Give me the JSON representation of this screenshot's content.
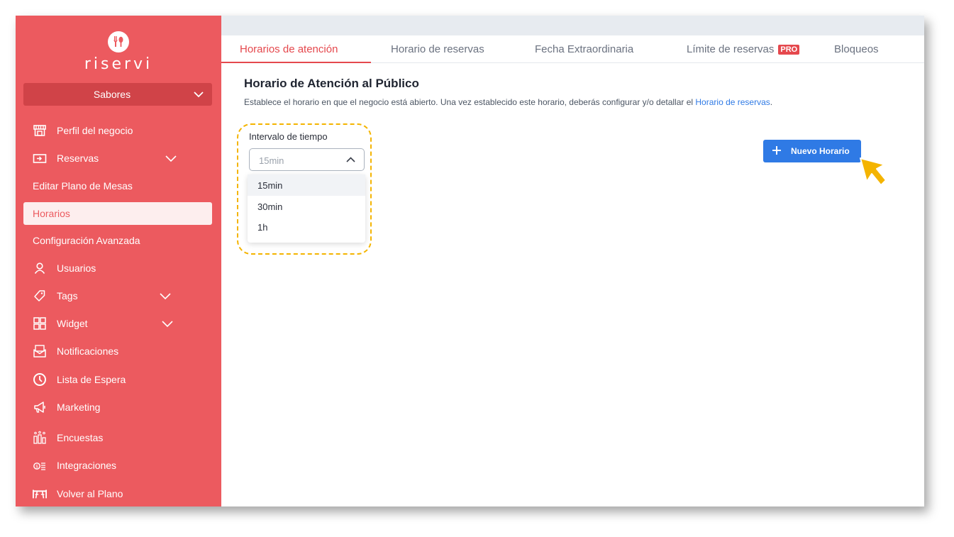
{
  "brand": {
    "name": "riservi"
  },
  "sidebar": {
    "restaurant_selector": "Sabores",
    "items": [
      {
        "label": "Perfil del negocio"
      },
      {
        "label": "Reservas"
      },
      {
        "label": "Editar Plano de Mesas"
      },
      {
        "label": "Horarios"
      },
      {
        "label": "Configuración Avanzada"
      },
      {
        "label": "Usuarios"
      },
      {
        "label": "Tags"
      },
      {
        "label": "Widget"
      },
      {
        "label": "Notificaciones"
      },
      {
        "label": "Lista de Espera"
      },
      {
        "label": "Marketing"
      },
      {
        "label": "Encuestas"
      },
      {
        "label": "Integraciones"
      },
      {
        "label": "Volver al Plano"
      }
    ],
    "active_item": "Horarios"
  },
  "tabs": [
    {
      "label": "Horarios de atención"
    },
    {
      "label": "Horario de reservas"
    },
    {
      "label": "Fecha Extraordinaria"
    },
    {
      "label": "Límite de reservas",
      "badge": "PRO"
    },
    {
      "label": "Bloqueos"
    }
  ],
  "active_tab": "Horarios de atención",
  "main": {
    "title": "Horario de Atención al Público",
    "description": "Establece el horario en que el negocio está abierto. Una vez establecido este horario, deberás configurar y/o detallar el ",
    "description_link": "Horario de reservas",
    "description_end": ".",
    "interval": {
      "label": "Intervalo de tiempo",
      "value": "15min",
      "options": [
        "15min",
        "30min",
        "1h"
      ],
      "selected": "15min"
    },
    "new_button_label": "Nuevo Horario"
  },
  "colors": {
    "sidebar": "#ec5a5f",
    "accent": "#e5484d",
    "primary_button": "#2f7ae5",
    "highlight": "#f4b400"
  }
}
